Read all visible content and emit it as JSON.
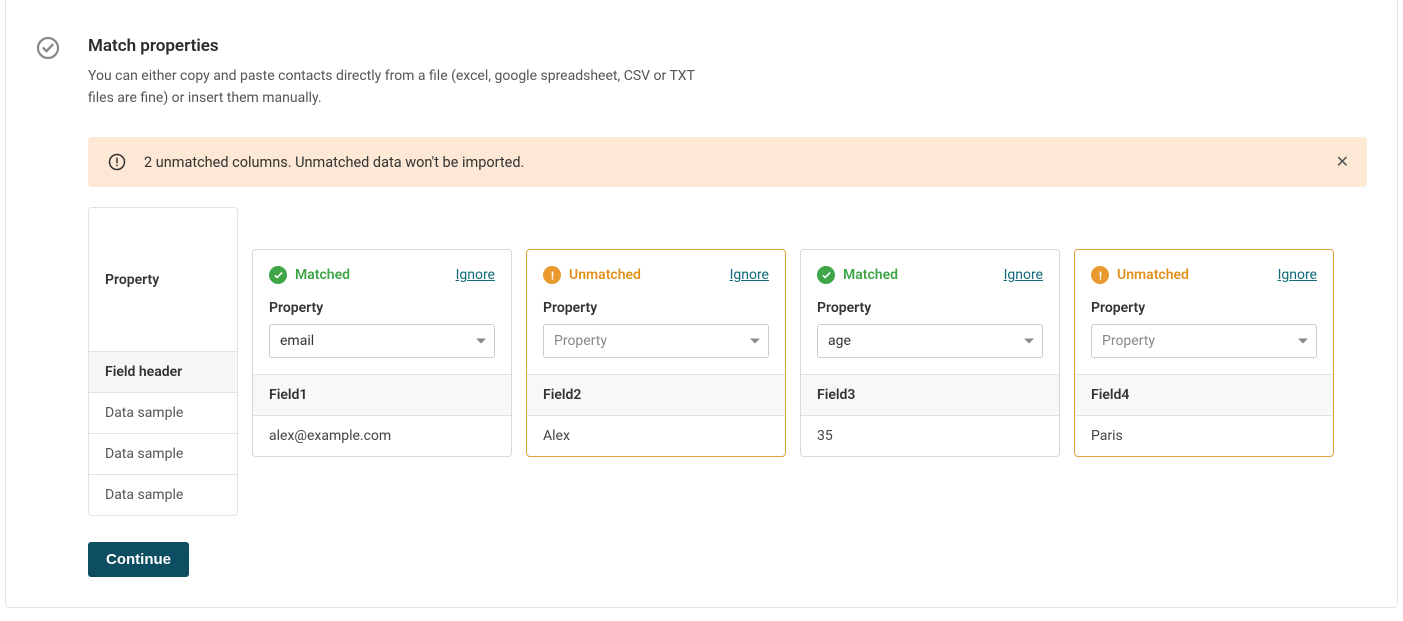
{
  "header": {
    "title": "Match properties",
    "subtitle": "You can either copy and paste contacts directly from a file (excel, google spreadsheet, CSV or TXT files are fine) or insert them manually."
  },
  "alert": {
    "text": "2 unmatched columns. Unmatched data won't be imported."
  },
  "legend": {
    "property": "Property",
    "field_header": "Field header",
    "sample1": "Data sample",
    "sample2": "Data sample",
    "sample3": "Data sample"
  },
  "labels": {
    "matched": "Matched",
    "unmatched": "Unmatched",
    "ignore": "Ignore",
    "property": "Property",
    "property_placeholder": "Property",
    "continue": "Continue"
  },
  "columns": [
    {
      "status": "matched",
      "selected": "email",
      "field": "Field1",
      "value": "alex@example.com"
    },
    {
      "status": "unmatched",
      "selected": "",
      "field": "Field2",
      "value": "Alex"
    },
    {
      "status": "matched",
      "selected": "age",
      "field": "Field3",
      "value": "35"
    },
    {
      "status": "unmatched",
      "selected": "",
      "field": "Field4",
      "value": "Paris"
    }
  ]
}
